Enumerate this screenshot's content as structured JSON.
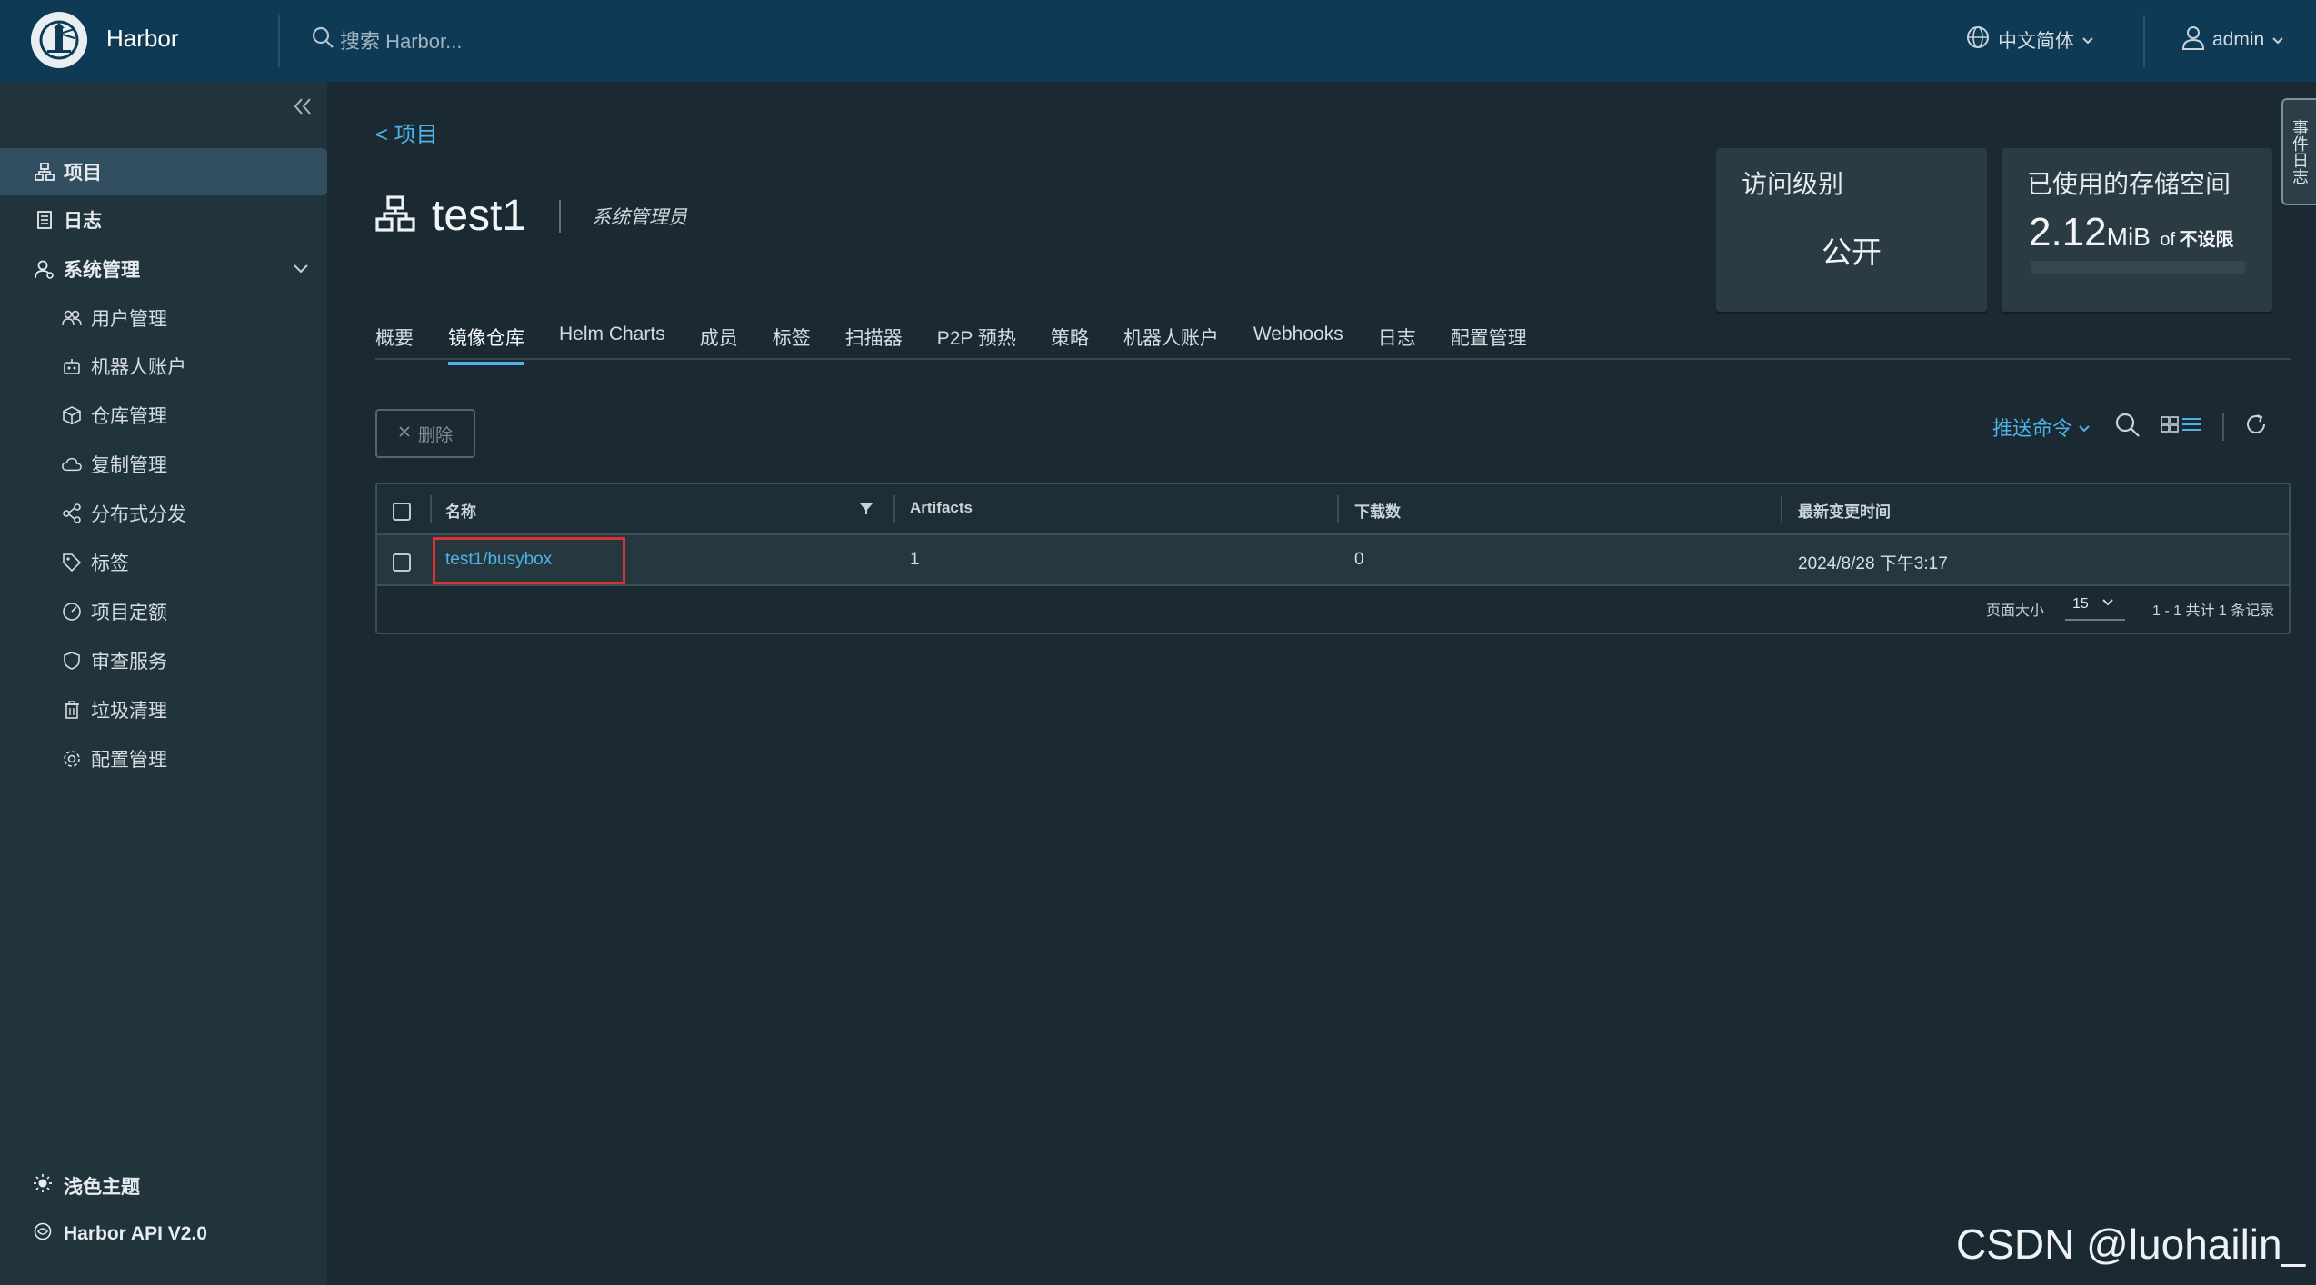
{
  "topbar": {
    "brand": "Harbor",
    "search_placeholder": "搜索 Harbor...",
    "language": "中文简体",
    "user": "admin"
  },
  "sidebar": {
    "items": [
      {
        "label": "项目"
      },
      {
        "label": "日志"
      },
      {
        "label": "系统管理"
      },
      {
        "label": "用户管理"
      },
      {
        "label": "机器人账户"
      },
      {
        "label": "仓库管理"
      },
      {
        "label": "复制管理"
      },
      {
        "label": "分布式分发"
      },
      {
        "label": "标签"
      },
      {
        "label": "项目定额"
      },
      {
        "label": "审查服务"
      },
      {
        "label": "垃圾清理"
      },
      {
        "label": "配置管理"
      }
    ],
    "theme_label": "浅色主题",
    "api_label": "Harbor API V2.0"
  },
  "breadcrumb": "< 项目",
  "project": {
    "name": "test1",
    "role": "系统管理员"
  },
  "access_card": {
    "title": "访问级别",
    "value": "公开"
  },
  "storage_card": {
    "title": "已使用的存储空间",
    "amount": "2.12",
    "unit": "MiB",
    "of": "of",
    "limit": "不设限"
  },
  "side_tab": "事件日志",
  "tabs": [
    "概要",
    "镜像仓库",
    "Helm Charts",
    "成员",
    "标签",
    "扫描器",
    "P2P 预热",
    "策略",
    "机器人账户",
    "Webhooks",
    "日志",
    "配置管理"
  ],
  "toolbar": {
    "delete_label": "删除",
    "push_label": "推送命令"
  },
  "table": {
    "columns": [
      "名称",
      "Artifacts",
      "下载数",
      "最新变更时间"
    ],
    "rows": [
      {
        "name": "test1/busybox",
        "artifacts": "1",
        "downloads": "0",
        "updated": "2024/8/28 下午3:17"
      }
    ],
    "page_size_label": "页面大小",
    "page_size": "15",
    "summary": "1 - 1 共计 1 条记录"
  },
  "watermark": "CSDN @luohailin_"
}
